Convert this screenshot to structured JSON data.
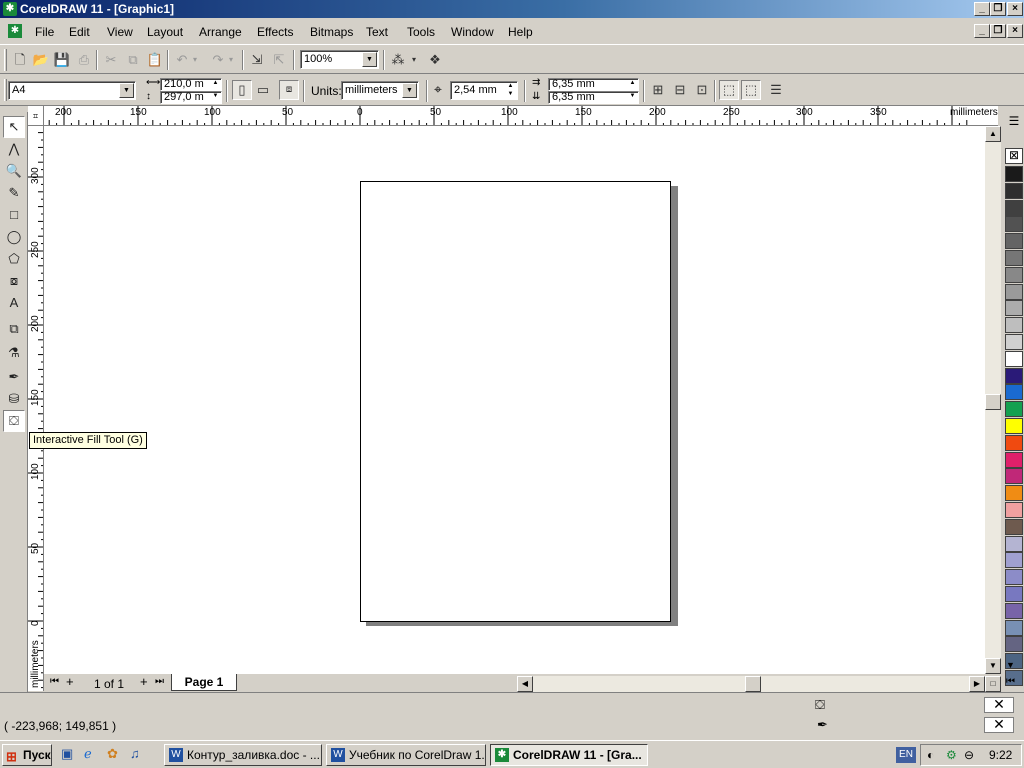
{
  "window": {
    "title": "CorelDRAW 11 - [Graphic1]",
    "caption_buttons": {
      "minimize": "_",
      "restore": "❐",
      "close": "×"
    }
  },
  "menu": {
    "items": [
      {
        "label": "File"
      },
      {
        "label": "Edit"
      },
      {
        "label": "View"
      },
      {
        "label": "Layout"
      },
      {
        "label": "Arrange"
      },
      {
        "label": "Effects"
      },
      {
        "label": "Bitmaps"
      },
      {
        "label": "Text"
      },
      {
        "label": "Tools"
      },
      {
        "label": "Window"
      },
      {
        "label": "Help"
      }
    ]
  },
  "standard_toolbar": {
    "zoom": "100%"
  },
  "property_bar": {
    "paper_size": "A4",
    "width": "210,0 m",
    "height": "297,0 m",
    "units_label": "Units:",
    "units_value": "millimeters",
    "nudge": "2,54 mm",
    "dup_x": "6,35 mm",
    "dup_y": "6,35 mm"
  },
  "rulers": {
    "unit": "millimeters",
    "h_labels": [
      "200",
      "150",
      "100",
      "50",
      "0",
      "50",
      "100",
      "150",
      "200",
      "250",
      "300",
      "350"
    ],
    "v_labels": [
      "300",
      "250",
      "200",
      "150",
      "100",
      "50",
      "0"
    ]
  },
  "tooltip": "Interactive Fill Tool (G)",
  "page_nav": {
    "counter": "1 of 1",
    "tab_label": "Page 1"
  },
  "status": {
    "coordinates": "( -223,968; 149,851 )"
  },
  "palette": {
    "colors": [
      "#1a1a1a",
      "#2e2e2e",
      "#404040",
      "#525252",
      "#646464",
      "#767676",
      "#888888",
      "#9a9a9a",
      "#acacac",
      "#bebebe",
      "#d0d0d0",
      "#ffffff",
      "#2a1a78",
      "#1a6ad0",
      "#14a050",
      "#ffff00",
      "#f04a10",
      "#e0206a",
      "#c02878",
      "#f08c14",
      "#f0a0a0",
      "#6e5a4e",
      "#b4b4d2",
      "#a0a0d0",
      "#8c8cc8",
      "#7878c0",
      "#7864a8",
      "#7890b4",
      "#646482",
      "#4c6482",
      "#586e8c"
    ]
  },
  "taskbar": {
    "start_label": "Пуск",
    "tasks": [
      {
        "label": "Контур_заливка.doc - ..."
      },
      {
        "label": "Учебник по CorelDraw 1..."
      },
      {
        "label": "CorelDRAW 11 - [Gra..."
      }
    ],
    "lang": "EN",
    "clock": "9:22"
  }
}
